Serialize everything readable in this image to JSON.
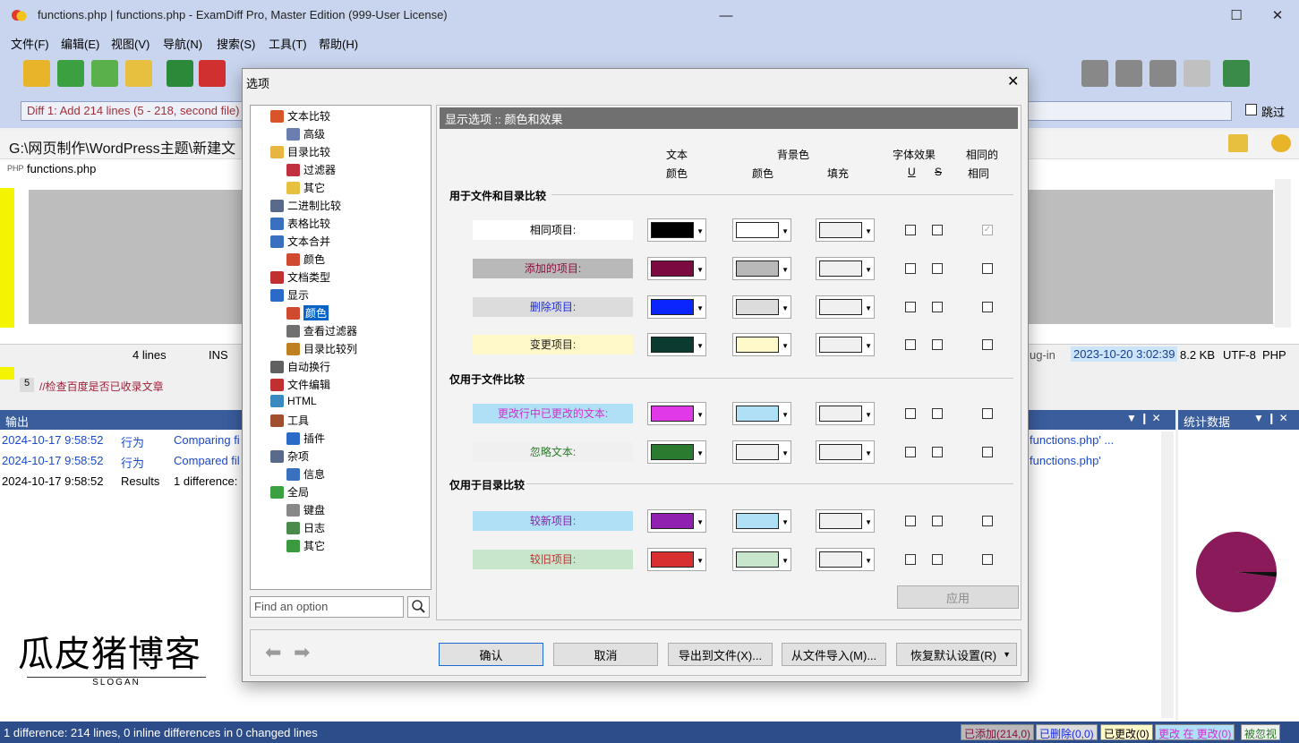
{
  "window": {
    "title": "functions.php  |  functions.php - ExamDiff Pro, Master Edition (999-User License)"
  },
  "menu": [
    "文件(F)",
    "编辑(E)",
    "视图(V)",
    "导航(N)",
    "搜索(S)",
    "工具(T)",
    "帮助(H)"
  ],
  "diff_selector": {
    "value": "Diff 1: Add 214 lines (5 - 218, second file)",
    "skip_label": "跳过"
  },
  "path": "G:\\网页制作\\WordPress主题\\新建文",
  "file_tab": "functions.php",
  "line_number": "5",
  "line_text": "//检查百度是否已收录文章",
  "status_left": {
    "lines": "4 lines",
    "mode": "INS"
  },
  "status_right": {
    "plugin": "ug-in",
    "date": "2023-10-20 3:02:39",
    "size": "8.2 KB",
    "enc": "UTF-8",
    "type": "PHP"
  },
  "output": {
    "title": "输出",
    "rows": [
      {
        "time": "2024-10-17 9:58:52",
        "kind": "行为",
        "text": "Comparing fi",
        "right": "functions.php' ..."
      },
      {
        "time": "2024-10-17 9:58:52",
        "kind": "行为",
        "text": "Compared fil",
        "right": "functions.php'"
      },
      {
        "time": "2024-10-17 9:58:52",
        "kind": "Results",
        "text": "1 difference:",
        "right": ""
      }
    ]
  },
  "stats": {
    "title": "统计数据",
    "added_fraction": 0.98
  },
  "logo": {
    "text": "瓜皮猪博客",
    "slogan": "SLOGAN"
  },
  "bottom": {
    "summary": "1 difference: 214 lines, 0 inline differences in 0 changed lines",
    "added": "已添加(214,0)",
    "deleted": "已删除(0,0)",
    "changed": "已更改(0)",
    "changed_in": "更改  在  更改(0)",
    "ignored": "被忽视"
  },
  "dialog": {
    "title": "选项",
    "tree": [
      {
        "label": "文本比较",
        "level": 0,
        "icon": "#d8552a"
      },
      {
        "label": "高级",
        "level": 1,
        "icon": "#6a7fb0"
      },
      {
        "label": "目录比较",
        "level": 0,
        "icon": "#e8b640"
      },
      {
        "label": "过滤器",
        "level": 1,
        "icon": "#c03040"
      },
      {
        "label": "其它",
        "level": 1,
        "icon": "#e8c040"
      },
      {
        "label": "二进制比较",
        "level": 0,
        "icon": "#5a6a8a"
      },
      {
        "label": "表格比较",
        "level": 0,
        "icon": "#3a70c0"
      },
      {
        "label": "文本合并",
        "level": 0,
        "icon": "#3a70c0"
      },
      {
        "label": "颜色",
        "level": 1,
        "icon": "#d04a30"
      },
      {
        "label": "文档类型",
        "level": 0,
        "icon": "#c03030"
      },
      {
        "label": "显示",
        "level": 0,
        "icon": "#2a6ac8"
      },
      {
        "label": "颜色",
        "level": 1,
        "icon": "#d04a30",
        "selected": true
      },
      {
        "label": "查看过滤器",
        "level": 1,
        "icon": "#707070"
      },
      {
        "label": "目录比较列",
        "level": 1,
        "icon": "#c08020"
      },
      {
        "label": "自动换行",
        "level": 0,
        "icon": "#606060"
      },
      {
        "label": "文件编辑",
        "level": 0,
        "icon": "#c03030"
      },
      {
        "label": "HTML",
        "level": 0,
        "icon": "#3a8ac0"
      },
      {
        "label": "工具",
        "level": 0,
        "icon": "#a05030"
      },
      {
        "label": "插件",
        "level": 1,
        "icon": "#2a6ac8"
      },
      {
        "label": "杂项",
        "level": 0,
        "icon": "#5a6a8a"
      },
      {
        "label": "信息",
        "level": 1,
        "icon": "#3a70c0"
      },
      {
        "label": "全局",
        "level": 0,
        "icon": "#3aa040"
      },
      {
        "label": "键盘",
        "level": 1,
        "icon": "#888888"
      },
      {
        "label": "日志",
        "level": 1,
        "icon": "#4a8a4a"
      },
      {
        "label": "其它",
        "level": 1,
        "icon": "#3a9a40"
      }
    ],
    "find_placeholder": "Find an option",
    "panel_title": "显示选项 :: 颜色和效果",
    "col_text": "文本",
    "col_color": "颜色",
    "col_bg": "背景色",
    "col_bg_color": "颜色",
    "col_fill": "填充",
    "col_font": "字体效果",
    "col_u": "U",
    "col_s": "S",
    "col_same": "相同的",
    "col_same2": "相同",
    "sections": [
      {
        "title": "用于文件和目录比较",
        "rows": [
          {
            "label": "相同项目:",
            "lbg": "#ffffff",
            "lfg": "#000000",
            "text": "#000000",
            "bg": "#ffffff",
            "fill": "#f0f0f0",
            "same_on": true,
            "same_disabled": true
          },
          {
            "label": "添加的项目:",
            "lbg": "#b9b9b9",
            "lfg": "#8a1040",
            "text": "#7a0a40",
            "bg": "#b9b9b9",
            "fill": "#f0f0f0",
            "same_on": false
          },
          {
            "label": "删除项目:",
            "lbg": "#dcdcdc",
            "lfg": "#1a2ae0",
            "text": "#0a25ff",
            "bg": "#dcdcdc",
            "fill": "#f0f0f0",
            "same_on": false
          },
          {
            "label": "变更项目:",
            "lbg": "#fff8c8",
            "lfg": "#202020",
            "text": "#0a3a30",
            "bg": "#fff8c8",
            "fill": "#f0f0f0",
            "same_on": false
          }
        ]
      },
      {
        "title": "仅用于文件比较",
        "rows": [
          {
            "label": "更改行中已更改的文本:",
            "lbg": "#b0e0f6",
            "lfg": "#d030d0",
            "text": "#e03ae8",
            "bg": "#b0e0f6",
            "fill": "#f0f0f0",
            "same_on": false
          },
          {
            "label": "忽略文本:",
            "lbg": "#f0f0f0",
            "lfg": "#2a7a2a",
            "text": "#2a7a30",
            "bg": "#f0f0f0",
            "fill": "#f0f0f0",
            "same_on": false
          }
        ]
      },
      {
        "title": "仅用于目录比较",
        "rows": [
          {
            "label": "较新项目:",
            "lbg": "#b0e0f6",
            "lfg": "#8a20b0",
            "text": "#9020b0",
            "bg": "#b0e0f6",
            "fill": "#f0f0f0",
            "same_on": false
          },
          {
            "label": "较旧项目:",
            "lbg": "#c8e6cc",
            "lfg": "#c03030",
            "text": "#d83030",
            "bg": "#c8e6cc",
            "fill": "#f0f0f0",
            "same_on": false
          }
        ]
      }
    ],
    "apply": "应用",
    "ok": "确认",
    "cancel": "取消",
    "export": "导出到文件(X)...",
    "import": "从文件导入(M)...",
    "restore": "恢复默认设置(R)"
  }
}
